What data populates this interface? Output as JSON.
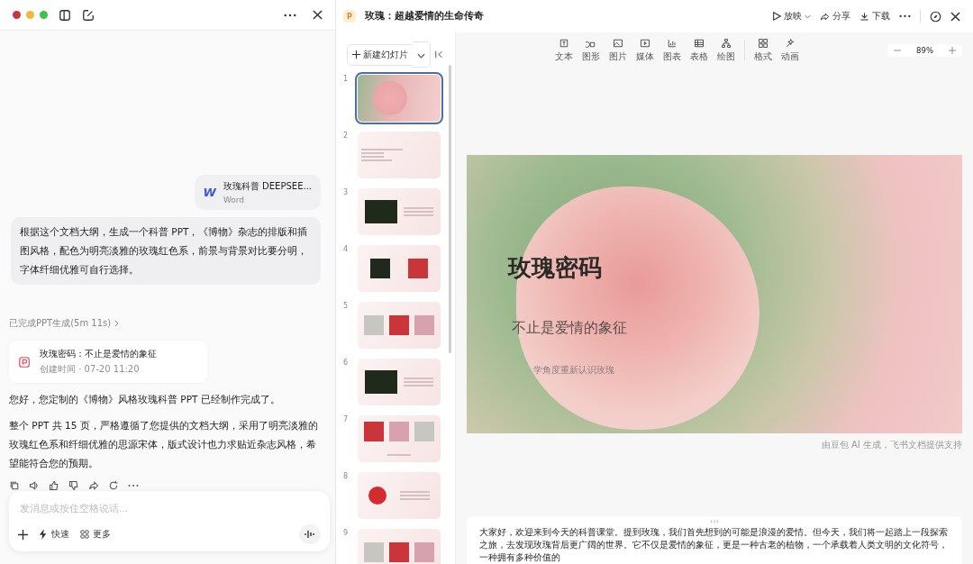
{
  "chat": {
    "attachment": {
      "name": "玫瑰科普 DEEPSEE...",
      "type": "Word",
      "icon_letter": "W"
    },
    "prompt": "根据这个文档大纲，生成一个科普 PPT，《博物》杂志的排版和插图风格，配色为明亮淡雅的玫瑰红色系，前景与背景对比要分明，字体纤细优雅可自行选择。",
    "status": "已完成PPT生成(5m 11s)",
    "result_card": {
      "title": "玫瑰密码：不止是爱情的象征",
      "meta": "创建时间 · 07-20 11:20"
    },
    "reply": [
      "您好，您定制的《博物》风格玫瑰科普 PPT 已经制作完成了。",
      "整个 PPT 共 15 页，严格遵循了您提供的文档大纲，采用了明亮淡雅的玫瑰红色系和纤细优雅的思源宋体，版式设计也力求贴近杂志风格，希望能符合您的预期。"
    ],
    "input": {
      "placeholder": "发消息或按住空格说话...",
      "quick": "快速",
      "more": "更多"
    }
  },
  "doc": {
    "title": "玫瑰：超越爱情的生命传奇",
    "badge": "P",
    "actions": [
      "放映",
      "分享",
      "下载"
    ],
    "new_slide": "新建幻灯片",
    "tools": [
      {
        "label": "文本",
        "kind": "text"
      },
      {
        "label": "图形",
        "kind": "shape"
      },
      {
        "label": "图片",
        "kind": "image"
      },
      {
        "label": "媒体",
        "kind": "media"
      },
      {
        "label": "图表",
        "kind": "chart"
      },
      {
        "label": "表格",
        "kind": "table"
      },
      {
        "label": "绘图",
        "kind": "diagram"
      },
      {
        "label": "格式",
        "kind": "format"
      },
      {
        "label": "动画",
        "kind": "animation"
      }
    ],
    "zoom": "89%",
    "slides": [
      {
        "number": "1",
        "kind": "cover",
        "selected": true
      },
      {
        "number": "2",
        "kind": "list",
        "selected": false
      },
      {
        "number": "3",
        "kind": "photo-text",
        "selected": false
      },
      {
        "number": "4",
        "kind": "two-photos",
        "selected": false
      },
      {
        "number": "5",
        "kind": "three-photos",
        "selected": false
      },
      {
        "number": "6",
        "kind": "photo-text",
        "selected": false
      },
      {
        "number": "7",
        "kind": "grid",
        "selected": false
      },
      {
        "number": "8",
        "kind": "emblem",
        "selected": false
      },
      {
        "number": "9",
        "kind": "three-photos",
        "selected": false
      }
    ],
    "current_slide": {
      "title": "玫瑰密码",
      "subtitle": "不止是爱情的象征",
      "tagline": "学角度重新认识玫瑰"
    },
    "credit": "由豆包 AI 生成，飞书文档提供支持",
    "notes": "大家好，欢迎来到今天的科普课堂。提到玫瑰，我们首先想到的可能是浪漫的爱情。但今天，我们将一起踏上一段探索之旅，去发现玫瑰背后更广阔的世界。它不仅是爱情的象征，更是一种古老的植物，一个承载着人类文明的文化符号，一种拥有多种价值的"
  }
}
